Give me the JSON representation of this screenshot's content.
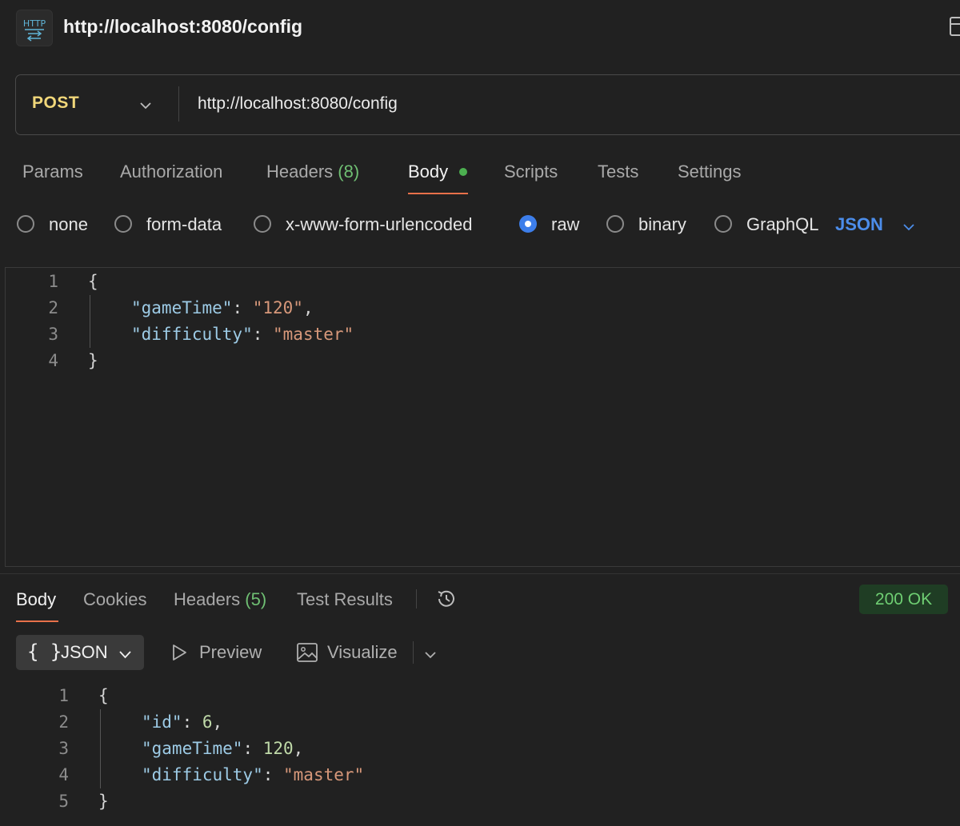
{
  "title": {
    "icon": "http-icon",
    "text": "http://localhost:8080/config"
  },
  "request": {
    "method": "POST",
    "url": "http://localhost:8080/config",
    "tabs": {
      "params": "Params",
      "authorization": "Authorization",
      "headers": "Headers",
      "headers_count": "(8)",
      "body": "Body",
      "scripts": "Scripts",
      "tests": "Tests",
      "settings": "Settings"
    },
    "active_tab": "Body",
    "body_modes": {
      "none": "none",
      "form_data": "form-data",
      "urlencoded": "x-www-form-urlencoded",
      "raw": "raw",
      "binary": "binary",
      "graphql": "GraphQL"
    },
    "selected_mode": "raw",
    "language": "JSON",
    "editor": {
      "line_numbers": [
        "1",
        "2",
        "3",
        "4"
      ],
      "open_brace": "{",
      "close_brace": "}",
      "line2_key": "\"gameTime\"",
      "line2_value": "\"120\"",
      "line3_key": "\"difficulty\"",
      "line3_value": "\"master\""
    }
  },
  "response": {
    "tabs": {
      "body": "Body",
      "cookies": "Cookies",
      "headers": "Headers",
      "headers_count": "(5)",
      "test_results": "Test Results"
    },
    "status": "200 OK",
    "format": {
      "braces": "{ }",
      "label": "JSON",
      "preview": "Preview",
      "visualize": "Visualize"
    },
    "editor": {
      "line_numbers": [
        "1",
        "2",
        "3",
        "4",
        "5"
      ],
      "open_brace": "{",
      "close_brace": "}",
      "line2_key": "\"id\"",
      "line2_value": "6",
      "line3_key": "\"gameTime\"",
      "line3_value": "120",
      "line4_key": "\"difficulty\"",
      "line4_value": "\"master\""
    }
  },
  "colors": {
    "background": "#212121",
    "method": "#f1d77a",
    "accent_underline": "#e8714a",
    "radio_selected": "#3d7eea",
    "json_key": "#9dcbe6",
    "json_string": "#d7987a",
    "json_number": "#bfd9a8",
    "status_ok": "#6fcf73"
  }
}
